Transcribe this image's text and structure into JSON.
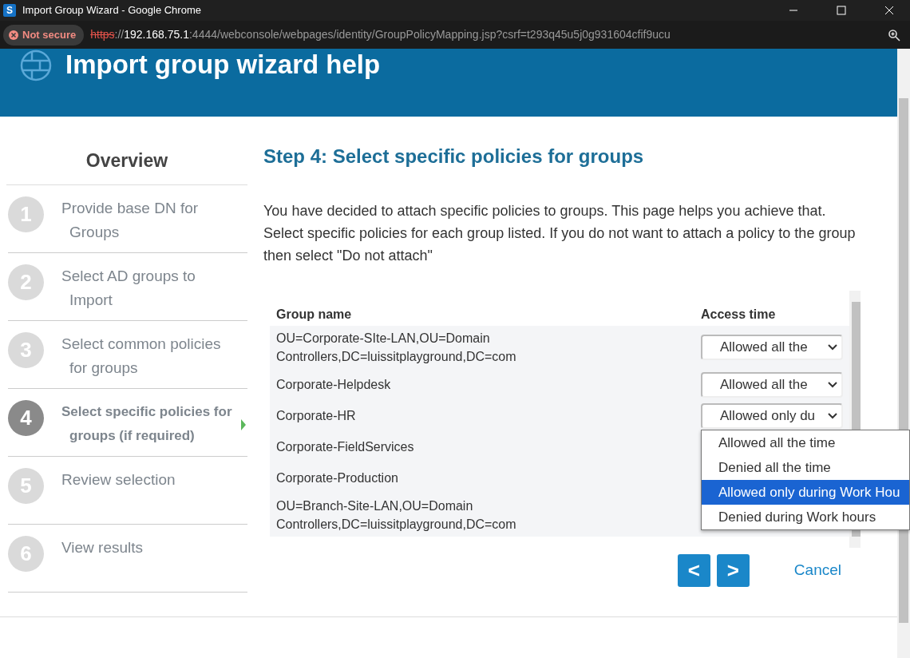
{
  "browser": {
    "favicon": "S",
    "title": "Import Group Wizard - Google Chrome",
    "security": "Not secure",
    "url_scheme": "https",
    "url_sep": "://",
    "url_host": "192.168.75.1",
    "url_rest": ":4444/webconsole/webpages/identity/GroupPolicyMapping.jsp?csrf=t293q45u5j0g931604cfif9ucu"
  },
  "header": {
    "title": "Import group wizard help"
  },
  "sidebar": {
    "heading": "Overview",
    "steps": [
      {
        "number": "1",
        "label": "Provide base DN for Groups",
        "selected": false
      },
      {
        "number": "2",
        "label": "Select AD groups to Import",
        "selected": false
      },
      {
        "number": "3",
        "label": "Select common policies for groups",
        "selected": false
      },
      {
        "number": "4",
        "label": "Select specific policies for groups (if required)",
        "selected": true
      },
      {
        "number": "5",
        "label": "Review selection",
        "selected": false
      },
      {
        "number": "6",
        "label": "View results",
        "selected": false
      }
    ]
  },
  "main": {
    "heading": "Step 4: Select specific policies for groups",
    "paragraphs": [
      "You have decided to attach specific policies to groups. This page helps you achieve that.",
      "Select specific policies for each group listed. If you do not want to attach a policy to the group then select \"Do not attach\""
    ]
  },
  "table": {
    "columns": [
      "Group name",
      "Access time"
    ],
    "rows": [
      {
        "group": "OU=Corporate-SIte-LAN,OU=Domain Controllers,DC=luissitplayground,DC=com",
        "access": "Allowed all the"
      },
      {
        "group": "Corporate-Helpdesk",
        "access": "Allowed all the"
      },
      {
        "group": "Corporate-HR",
        "access": "Allowed only du"
      },
      {
        "group": "Corporate-FieldServices"
      },
      {
        "group": "Corporate-Production"
      },
      {
        "group": "OU=Branch-Site-LAN,OU=Domain Controllers,DC=luissitplayground,DC=com"
      }
    ]
  },
  "dropdown": {
    "options": [
      {
        "label": "Allowed all the time",
        "selected": false
      },
      {
        "label": "Denied all the time",
        "selected": false
      },
      {
        "label": "Allowed only during Work Hou",
        "selected": true
      },
      {
        "label": "Denied during Work hours",
        "selected": false
      }
    ]
  },
  "nav": {
    "back": "<",
    "next": ">",
    "cancel": "Cancel"
  }
}
